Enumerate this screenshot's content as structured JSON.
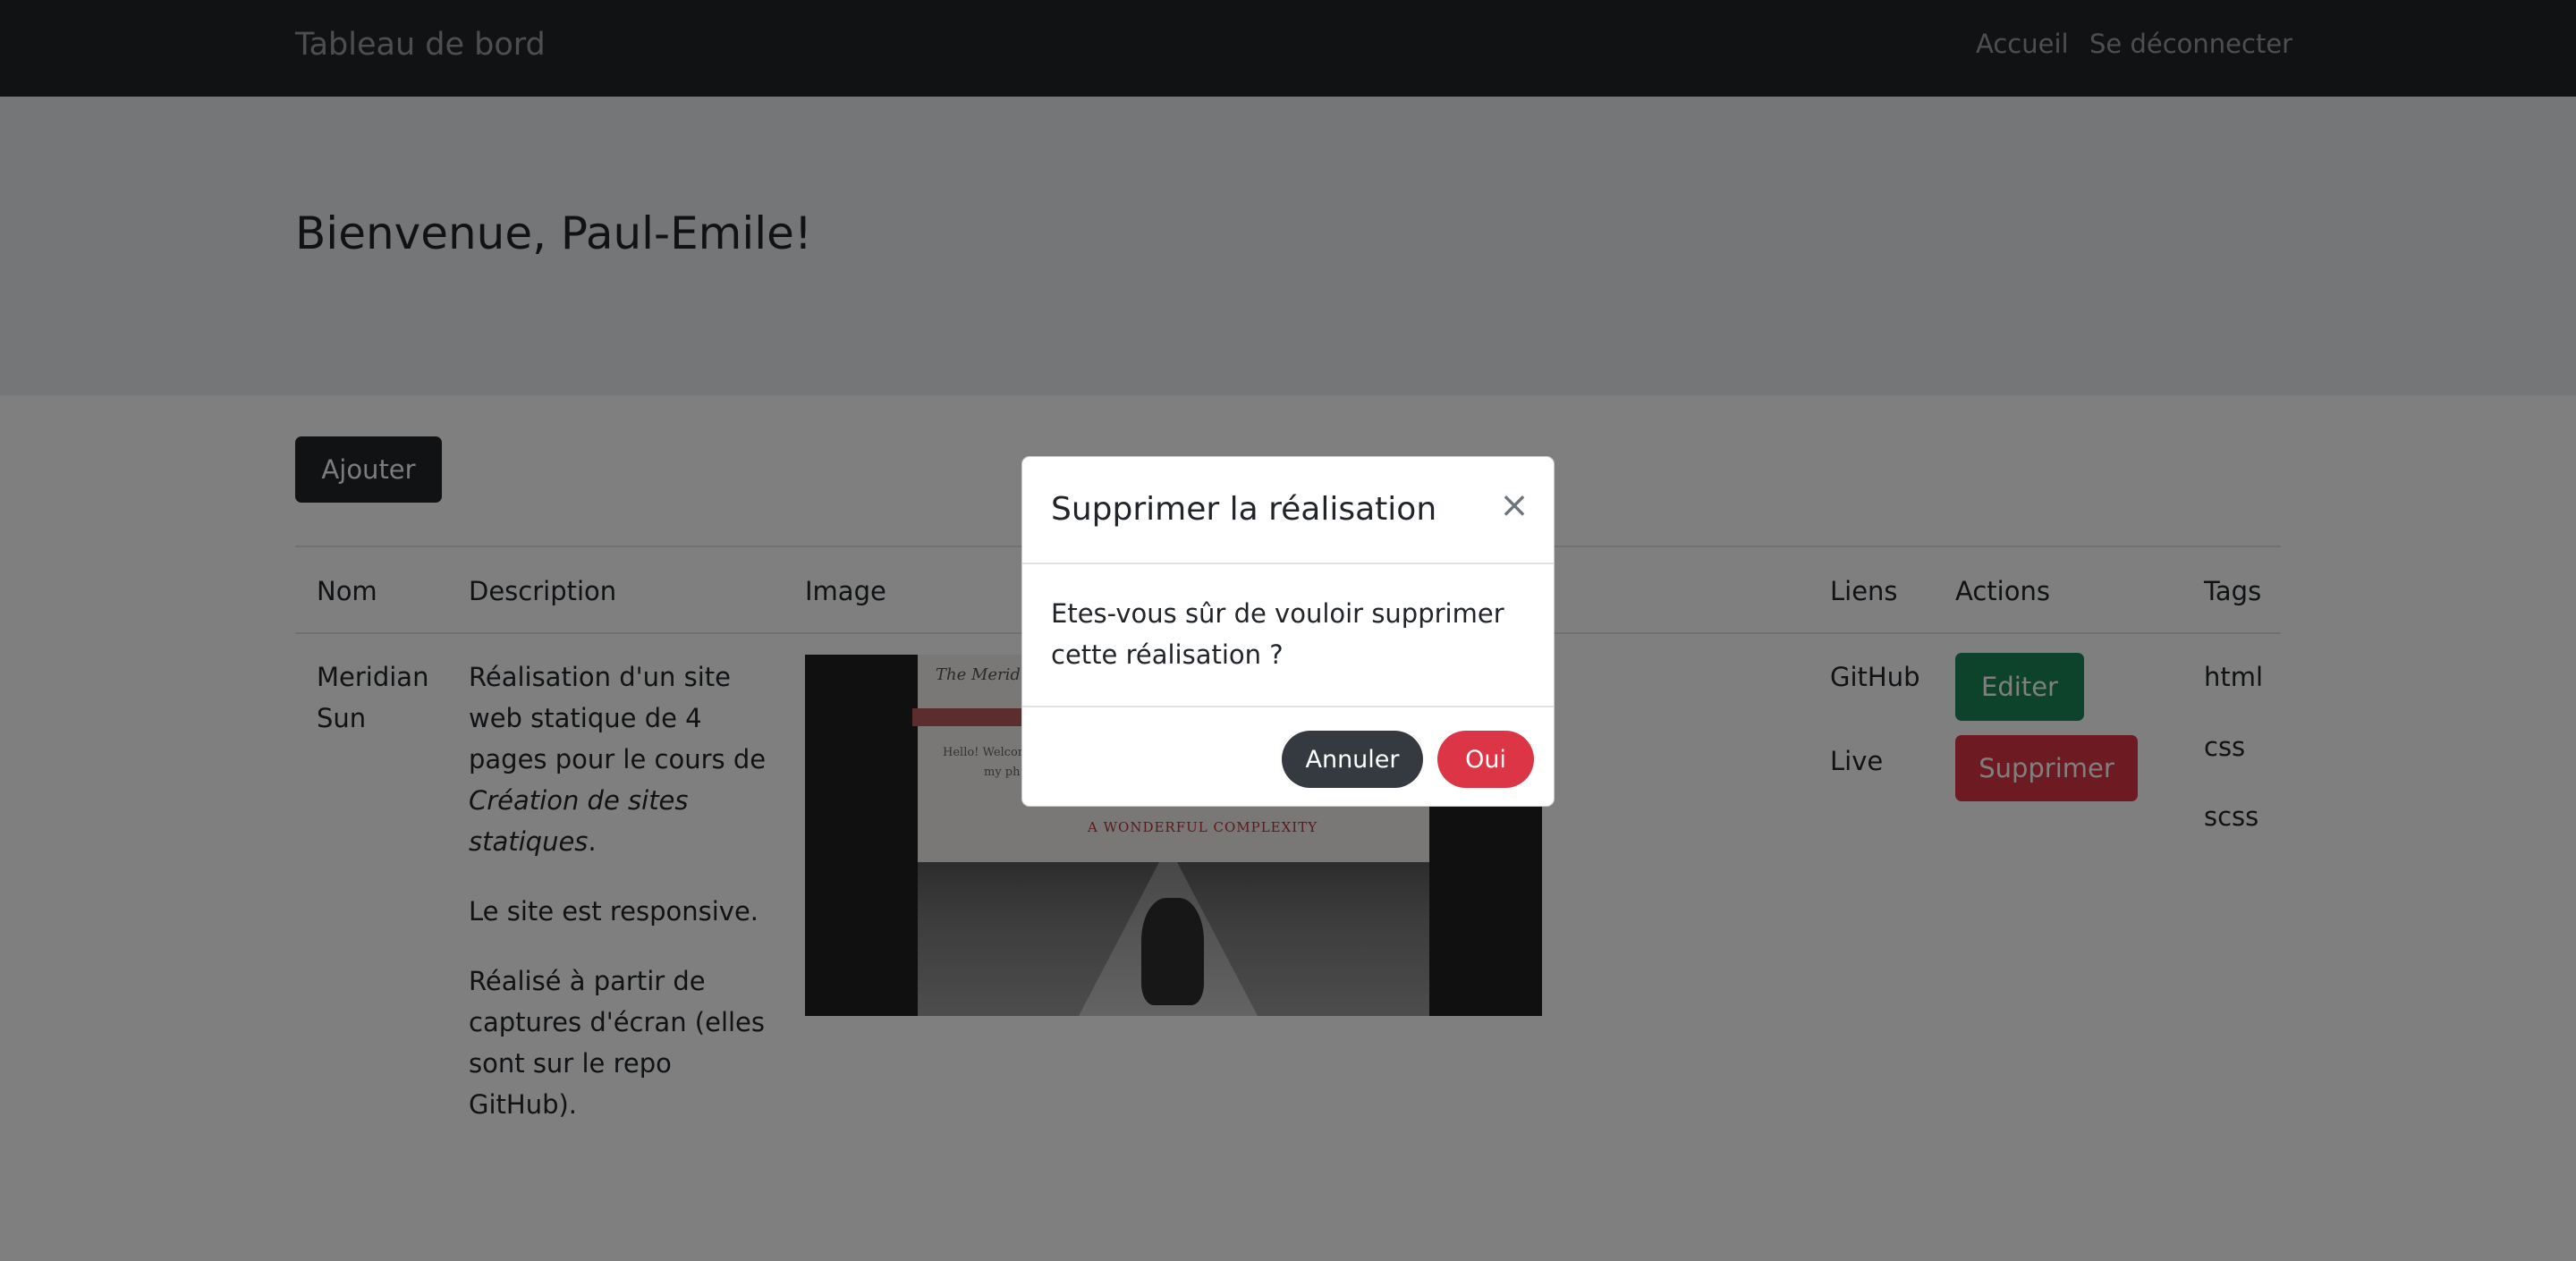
{
  "navbar": {
    "brand": "Tableau de bord",
    "links": [
      "Accueil",
      "Se déconnecter"
    ]
  },
  "hero": {
    "title": "Bienvenue, Paul-Emile!"
  },
  "toolbar": {
    "add_label": "Ajouter"
  },
  "table": {
    "headers": [
      "Nom",
      "Description",
      "Image",
      "Liens",
      "Actions",
      "Tags"
    ],
    "rows": [
      {
        "nom": "Meridian Sun",
        "description_p1_before": "Réalisation d'un site web statique de 4 pages pour le cours de ",
        "description_p1_italic": "Création de sites statiques",
        "description_p1_after": ".",
        "description_p2": "Le site est responsive.",
        "description_p3": "Réalisé à partir de captures d'écran (elles sont sur le repo GitHub).",
        "image": {
          "title": "The Meridian",
          "welcome": "Hello! Welcome",
          "my": "my ph",
          "heading": "A WONDERFUL COMPLEXITY"
        },
        "links": [
          "GitHub",
          "Live"
        ],
        "actions": [
          "Editer",
          "Supprimer"
        ],
        "tags": [
          "html",
          "css",
          "scss"
        ]
      }
    ]
  },
  "modal": {
    "title": "Supprimer la réalisation",
    "close_icon": "×",
    "body": "Etes-vous sûr de vouloir supprimer cette réalisation ?",
    "cancel_label": "Annuler",
    "confirm_label": "Oui"
  },
  "colors": {
    "navbar": "#212529",
    "hero": "#e9ecef",
    "success": "#198754",
    "danger": "#dc3545",
    "dark": "#343a40"
  }
}
